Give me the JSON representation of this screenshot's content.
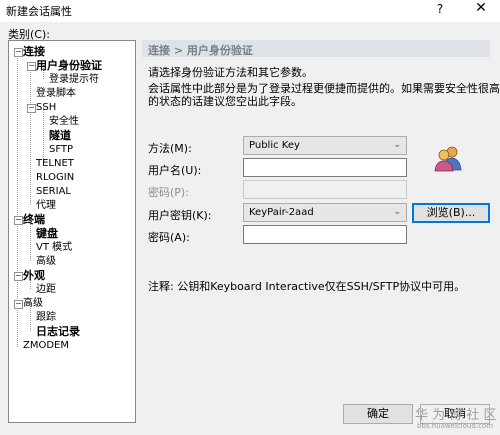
{
  "window": {
    "title": "新建会话属性",
    "help_glyph": "?",
    "close_glyph": "✕"
  },
  "category_label": "类别(C):",
  "tree": [
    {
      "label": "连接",
      "bold": true,
      "expander": "−"
    },
    {
      "label": "用户身份验证",
      "bold": true,
      "expander": "−"
    },
    {
      "label": "登录提示符",
      "bold": false
    },
    {
      "label": "登录脚本",
      "bold": false
    },
    {
      "label": "SSH",
      "bold": false,
      "expander": "−"
    },
    {
      "label": "安全性",
      "bold": false
    },
    {
      "label": "隧道",
      "bold": true
    },
    {
      "label": "SFTP",
      "bold": false
    },
    {
      "label": "TELNET",
      "bold": false
    },
    {
      "label": "RLOGIN",
      "bold": false
    },
    {
      "label": "SERIAL",
      "bold": false
    },
    {
      "label": "代理",
      "bold": false
    },
    {
      "label": "终端",
      "bold": true,
      "expander": "−"
    },
    {
      "label": "键盘",
      "bold": true
    },
    {
      "label": "VT 模式",
      "bold": false
    },
    {
      "label": "高级",
      "bold": false
    },
    {
      "label": "外观",
      "bold": true,
      "expander": "−"
    },
    {
      "label": "边距",
      "bold": false
    },
    {
      "label": "高级",
      "bold": false,
      "expander": "−"
    },
    {
      "label": "跟踪",
      "bold": false
    },
    {
      "label": "日志记录",
      "bold": true
    },
    {
      "label": "ZMODEM",
      "bold": false
    }
  ],
  "panel": {
    "heading": "连接 > 用户身份验证",
    "intro": "请选择身份验证方法和其它参数。",
    "desc_line1": "会话属性中此部分是为了登录过程更便捷而提供的。如果需要安全性很高",
    "desc_line2": "的状态的话建议您空出此字段。",
    "method_label": "方法(M):",
    "method_value": "Public Key",
    "username_label": "用户名(U):",
    "username_value": "",
    "password_label": "密码(P):",
    "userkey_label": "用户密钥(K):",
    "userkey_value": "KeyPair-2aad",
    "browse_label": "浏览(B)...",
    "passphrase_label": "密码(A):",
    "passphrase_value": "",
    "note": "注释: 公钥和Keyboard Interactive仅在SSH/SFTP协议中可用。"
  },
  "footer": {
    "ok_label": "确定",
    "cancel_label": "取消"
  },
  "watermark": {
    "text": "华 为 博 社 区",
    "url": "bbs.huaweicloud.com"
  },
  "icons": {
    "users": "users-icon",
    "dropdown": "chevron-down-icon"
  }
}
